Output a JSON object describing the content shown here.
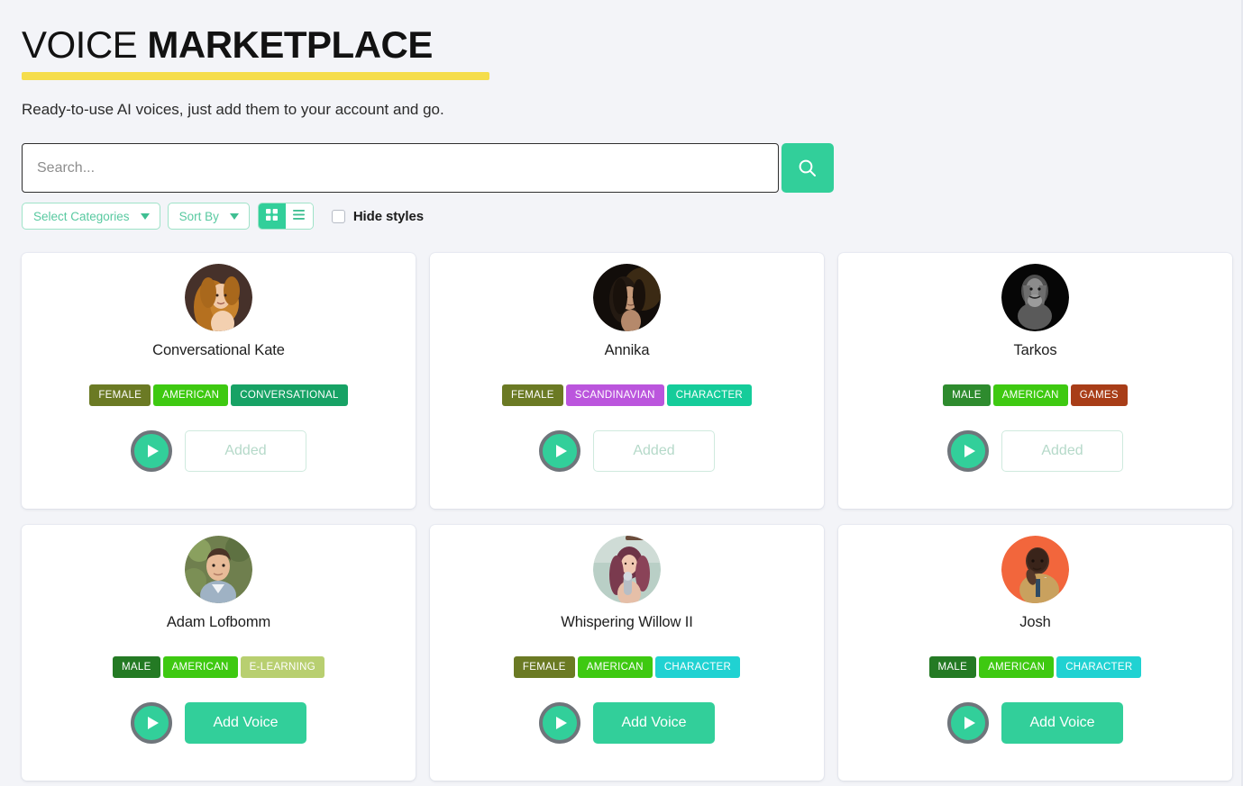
{
  "header": {
    "title_light": "VOICE",
    "title_bold": "MARKETPLACE",
    "subtitle": "Ready-to-use AI voices, just add them to your account and go.",
    "underline_color": "#f5dd4b"
  },
  "search": {
    "placeholder": "Search...",
    "value": "",
    "button_icon": "search-icon",
    "button_color": "#32cf9a"
  },
  "filters": {
    "categories_label": "Select Categories",
    "sort_label": "Sort By",
    "grid_view_icon": "grid-view-icon",
    "list_view_icon": "list-view-icon",
    "active_view": "grid",
    "hide_styles_label": "Hide styles",
    "hide_styles_checked": false,
    "accent_color": "#32cf9a",
    "pill_border_color": "#9fe3c8"
  },
  "badge_colors": {
    "FEMALE": "#6b7a24",
    "MALE": "#2e8b2e",
    "MALE_DARK": "#247a24",
    "AMERICAN": "#3ec911",
    "SCANDINAVIAN": "#bb55dd",
    "CONVERSATIONAL": "#17a265",
    "CHARACTER_MINT": "#15cc9a",
    "CHARACTER_CYAN": "#20d2d2",
    "GAMES": "#a83d18",
    "E-LEARNING": "#b8cf70"
  },
  "cards": [
    {
      "name": "Conversational Kate",
      "avatar": "avatar-conversational-kate",
      "badges": [
        {
          "label": "FEMALE",
          "color": "#6b7a24"
        },
        {
          "label": "AMERICAN",
          "color": "#3ec911"
        },
        {
          "label": "CONVERSATIONAL",
          "color": "#17a265"
        }
      ],
      "play_label": "play-icon",
      "action_label": "Added",
      "action_state": "added"
    },
    {
      "name": "Annika",
      "avatar": "avatar-annika",
      "badges": [
        {
          "label": "FEMALE",
          "color": "#6b7a24"
        },
        {
          "label": "SCANDINAVIAN",
          "color": "#bb55dd"
        },
        {
          "label": "CHARACTER",
          "color": "#15cc9a"
        }
      ],
      "play_label": "play-icon",
      "action_label": "Added",
      "action_state": "added"
    },
    {
      "name": "Tarkos",
      "avatar": "avatar-tarkos",
      "badges": [
        {
          "label": "MALE",
          "color": "#2e8b2e"
        },
        {
          "label": "AMERICAN",
          "color": "#3ec911"
        },
        {
          "label": "GAMES",
          "color": "#a83d18"
        }
      ],
      "play_label": "play-icon",
      "action_label": "Added",
      "action_state": "added"
    },
    {
      "name": "Adam Lofbomm",
      "avatar": "avatar-adam-lofbomm",
      "badges": [
        {
          "label": "MALE",
          "color": "#247a24"
        },
        {
          "label": "AMERICAN",
          "color": "#3ec911"
        },
        {
          "label": "E-LEARNING",
          "color": "#b8cf70"
        }
      ],
      "play_label": "play-icon",
      "action_label": "Add Voice",
      "action_state": "addvoice"
    },
    {
      "name": "Whispering Willow II",
      "avatar": "avatar-whispering-willow-ii",
      "badges": [
        {
          "label": "FEMALE",
          "color": "#6b7a24"
        },
        {
          "label": "AMERICAN",
          "color": "#3ec911"
        },
        {
          "label": "CHARACTER",
          "color": "#20d2d2"
        }
      ],
      "play_label": "play-icon",
      "action_label": "Add Voice",
      "action_state": "addvoice"
    },
    {
      "name": "Josh",
      "avatar": "avatar-josh",
      "badges": [
        {
          "label": "MALE",
          "color": "#247a24"
        },
        {
          "label": "AMERICAN",
          "color": "#3ec911"
        },
        {
          "label": "CHARACTER",
          "color": "#20d2d2"
        }
      ],
      "play_label": "play-icon",
      "action_label": "Add Voice",
      "action_state": "addvoice"
    }
  ]
}
